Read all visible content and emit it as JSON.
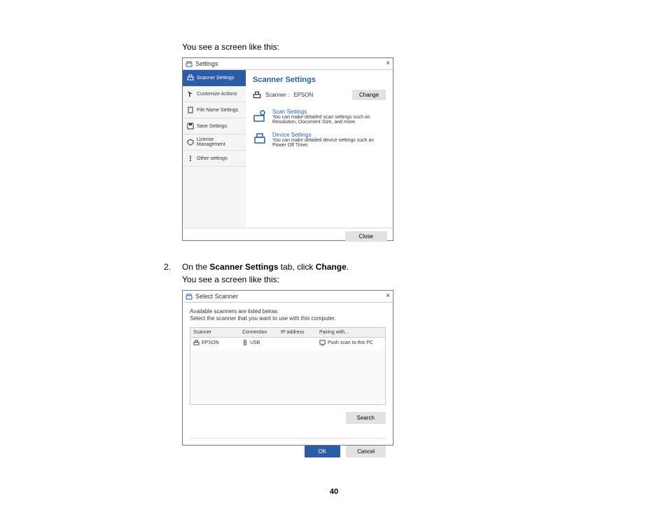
{
  "intro1": "You see a screen like this:",
  "step": {
    "num": "2.",
    "pre": "On the ",
    "b1": "Scanner Settings",
    "mid": " tab, click ",
    "b2": "Change",
    "post": "."
  },
  "intro2": "You see a screen like this:",
  "page_number": "40",
  "win1": {
    "title": "Settings",
    "sidebar": {
      "items": [
        {
          "label": "Scanner Settings"
        },
        {
          "label": "Customize Actions"
        },
        {
          "label": "File Name Settings"
        },
        {
          "label": "Save Settings"
        },
        {
          "label": "License Management"
        },
        {
          "label": "Other settings"
        }
      ]
    },
    "heading": "Scanner Settings",
    "scanner_label": "Scanner :",
    "scanner_value": "EPSON",
    "change_button": "Change",
    "cards": [
      {
        "title": "Scan Settings",
        "desc": "You can make detailed scan settings such as Resolution, Document Size, and more."
      },
      {
        "title": "Device Settings",
        "desc": "You can make detailed device settings such as Power Off Timer."
      }
    ],
    "close_button": "Close"
  },
  "win2": {
    "title": "Select Scanner",
    "intro_l1": "Available scanners are listed below.",
    "intro_l2": "Select the scanner that you want to use with this computer.",
    "columns": {
      "scanner": "Scanner",
      "connection": "Connection",
      "ip": "IP address",
      "pairing": "Pairing with..."
    },
    "row": {
      "scanner": "EPSON",
      "connection": "USB",
      "ip": "",
      "pairing": "Push scan to this PC"
    },
    "search_button": "Search",
    "ok_button": "OK",
    "cancel_button": "Cancel"
  }
}
